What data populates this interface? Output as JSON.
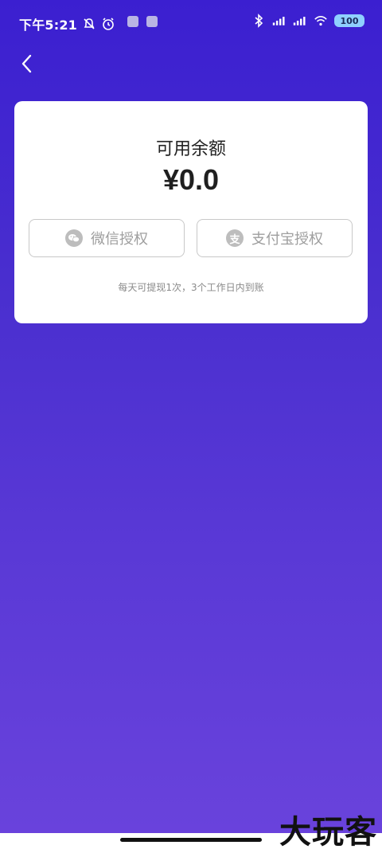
{
  "status_bar": {
    "time": "下午5:21",
    "battery": "100"
  },
  "card": {
    "balance_label": "可用余额",
    "balance_amount": "¥0.0",
    "wechat_auth_label": "微信授权",
    "alipay_auth_label": "支付宝授权",
    "alipay_icon_text": "支",
    "note": "每天可提现1次，3个工作日内到账"
  },
  "watermark": "大玩客",
  "icons": {
    "back": "chevron-left-icon",
    "wechat": "wechat-icon",
    "alipay": "alipay-icon",
    "bluetooth": "bluetooth-icon",
    "signal": "signal-icon",
    "wifi": "wifi-icon",
    "alarm": "alarm-icon",
    "mute": "bell-off-icon"
  },
  "colors": {
    "background_top": "#3b1fd0",
    "background_bottom": "#6a43dc",
    "card": "#ffffff",
    "button_border": "#c8c8c8",
    "button_text": "#9e9e9e"
  }
}
